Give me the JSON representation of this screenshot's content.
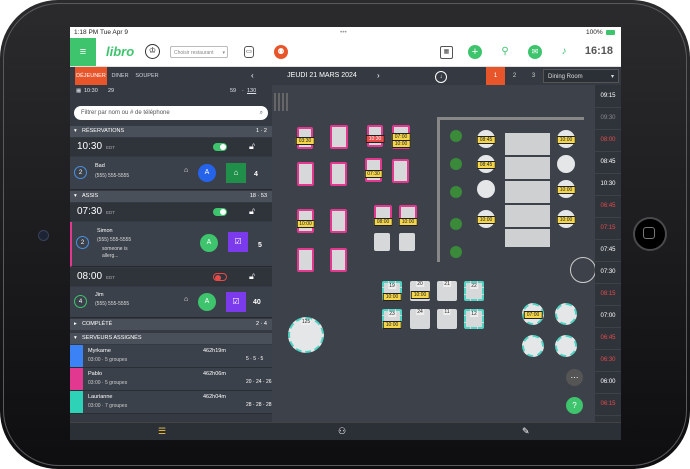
{
  "status": {
    "time": "1:18 PM",
    "date": "Tue Apr 9",
    "battery": "100%"
  },
  "app": {
    "logo": "libro",
    "restaurant_placeholder": "Choisir restaurant",
    "clock": "16:18",
    "accent": "#e8552b",
    "brand": "#3ec46d"
  },
  "shifts": [
    "DÉJEUNER",
    "DINER",
    "SOUPER"
  ],
  "date_label": "JEUDI 21 MARS 2024",
  "pages": [
    "1",
    "2",
    "3"
  ],
  "room": "Dining Room",
  "stats": {
    "time": "10:30",
    "pending": "29",
    "covers": "59",
    "capacity": "130"
  },
  "search_placeholder": "Filtrer par nom ou # de téléphone",
  "reservations": {
    "header": "RÉSERVATIONS",
    "count": "1 · 2",
    "time": "10:30",
    "edt": "EDT",
    "card": {
      "num": "2",
      "name": "Bad",
      "phone": "(555) 555-5555",
      "avatar": "A",
      "party": "4"
    }
  },
  "seated": {
    "header": "ASSIS",
    "count": "18 · 53",
    "slots": [
      {
        "time": "07:30",
        "edt": "EDT"
      },
      {
        "time": "08:00",
        "edt": "EDT"
      }
    ],
    "cards": [
      {
        "num": "2",
        "name": "Simon",
        "phone": "(555) 555-5555",
        "note1": "someone is",
        "note2": "allerg...",
        "avatar": "A",
        "party": "5"
      },
      {
        "num": "4",
        "name": "Jim",
        "phone": "(555) 555-5555",
        "avatar": "A",
        "party": "40"
      }
    ]
  },
  "completed": {
    "header": "COMPLÉTÉ",
    "count": "2 · 4"
  },
  "servers": {
    "header": "SERVEURS ASSIGNÉS",
    "list": [
      {
        "name": "Myrkarne",
        "sub": "03:00 · 5 groupes",
        "time": "462h19m",
        "count": "5 · 5 · 5",
        "color": "#3b82f6"
      },
      {
        "name": "Pablo",
        "sub": "03:00 · 5 groupes",
        "time": "462h06m",
        "count": "20 · 24 · 26",
        "color": "#e2388f"
      },
      {
        "name": "Laurianne",
        "sub": "03:00 · 7 groupes",
        "time": "462h04m",
        "count": "28 · 28 · 28",
        "color": "#2ed3b7"
      }
    ]
  },
  "floor": {
    "tags": [
      "03:30",
      "07:00",
      "10:00",
      "10:30",
      "10:00",
      "07:30",
      "08:00",
      "10:00",
      "10:00",
      "10:00",
      "08:45",
      "08:45",
      "10:00",
      "10:00",
      "10:00",
      "10:00",
      "10:00",
      "07:00"
    ],
    "table_numbers": [
      "125",
      "19",
      "20",
      "21",
      "22",
      "23",
      "24",
      "11",
      "12",
      "13",
      "14",
      "15",
      "7",
      "5"
    ]
  },
  "timeline": [
    "09:15",
    "09:30",
    "08:00",
    "08:45",
    "10:30",
    "06:45",
    "07:15",
    "07:45",
    "07:30",
    "08:15",
    "07:00",
    "06:45",
    "06:30",
    "06:00",
    "06:15"
  ]
}
